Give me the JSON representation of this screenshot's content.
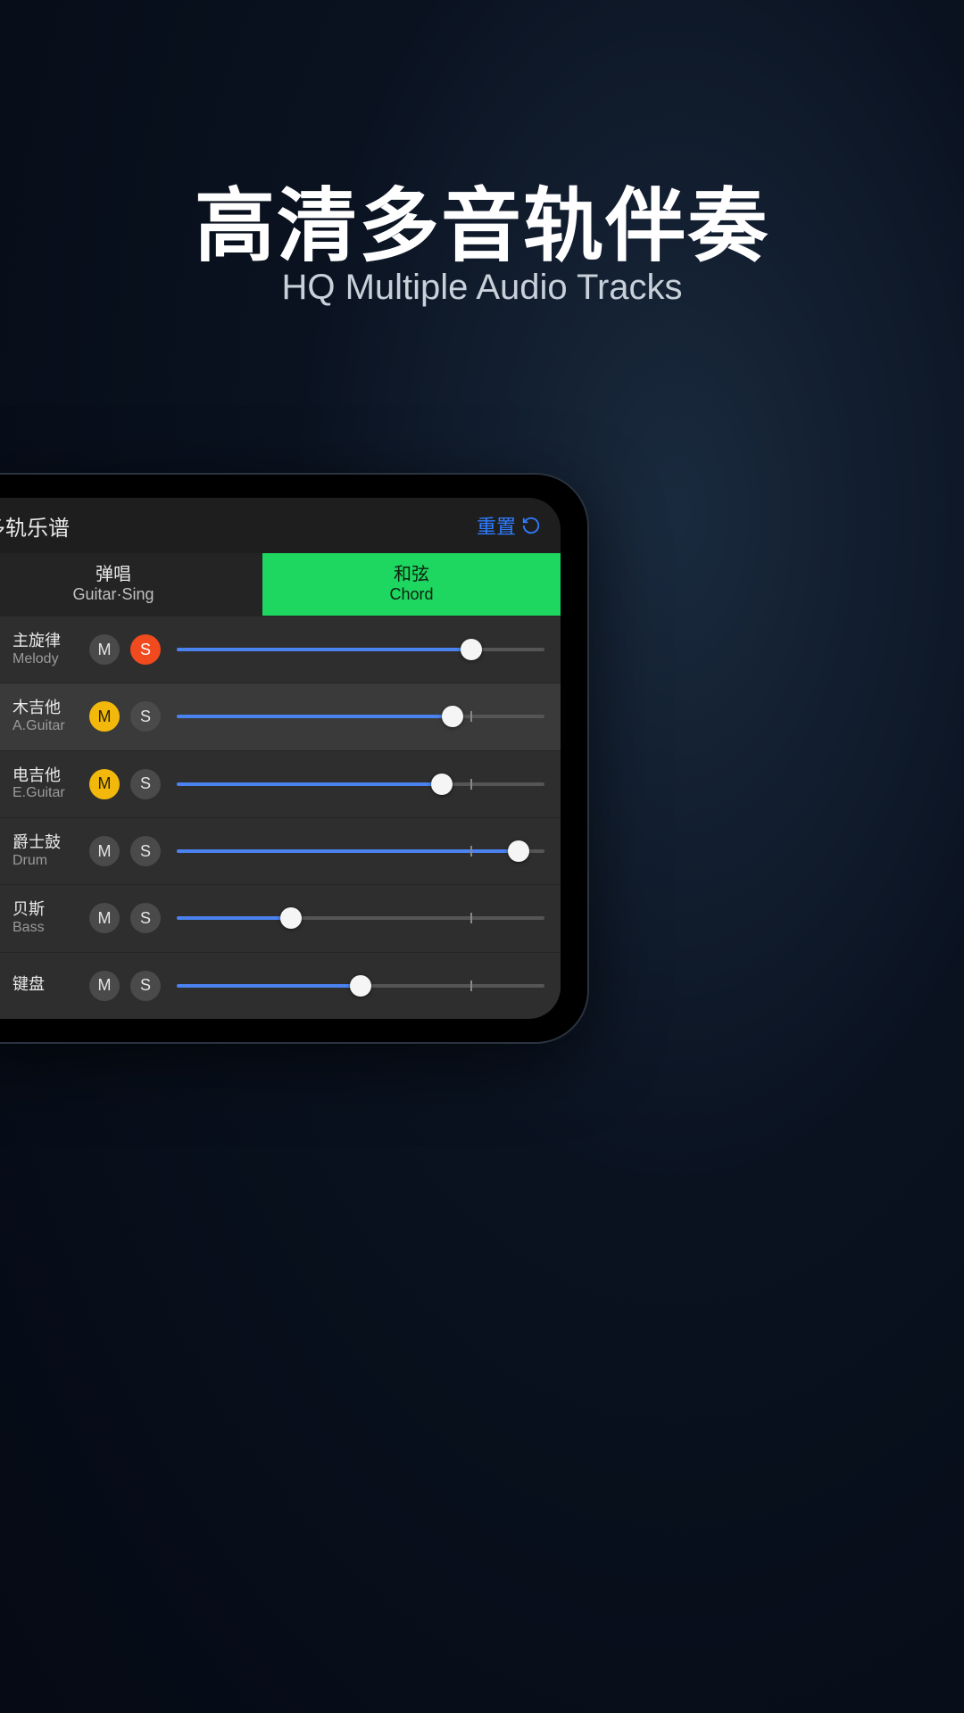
{
  "hero": {
    "title_cn": "高清多音轨伴奏",
    "subtitle_en": "HQ Multiple Audio Tracks"
  },
  "app": {
    "header_title": "多轨乐谱",
    "reset_label": "重置",
    "tabs": [
      {
        "cn": "弹唱",
        "en": "Guitar·Sing",
        "active": false
      },
      {
        "cn": "和弦",
        "en": "Chord",
        "active": true
      }
    ]
  },
  "ms_labels": {
    "mute": "M",
    "solo": "S"
  },
  "tracks": [
    {
      "icon": "person",
      "cn": "主旋律",
      "en": "Melody",
      "mute": false,
      "solo": true,
      "volume": 80,
      "selected": false
    },
    {
      "icon": "mic",
      "cn": "木吉他",
      "en": "A.Guitar",
      "mute": true,
      "solo": false,
      "volume": 75,
      "selected": true
    },
    {
      "icon": "eguitar",
      "cn": "电吉他",
      "en": "E.Guitar",
      "mute": true,
      "solo": false,
      "volume": 72,
      "selected": false
    },
    {
      "icon": "drum",
      "cn": "爵士鼓",
      "en": "Drum",
      "mute": false,
      "solo": false,
      "volume": 93,
      "selected": false
    },
    {
      "icon": "bass",
      "cn": "贝斯",
      "en": "Bass",
      "mute": false,
      "solo": false,
      "volume": 31,
      "selected": false
    },
    {
      "icon": "piano",
      "cn": "键盘",
      "en": "",
      "mute": false,
      "solo": false,
      "volume": 50,
      "selected": false
    }
  ],
  "colors": {
    "accent_green": "#1ed760",
    "accent_blue": "#2f7cff",
    "mute_active": "#f2b90c",
    "solo_active": "#f04a1e"
  }
}
